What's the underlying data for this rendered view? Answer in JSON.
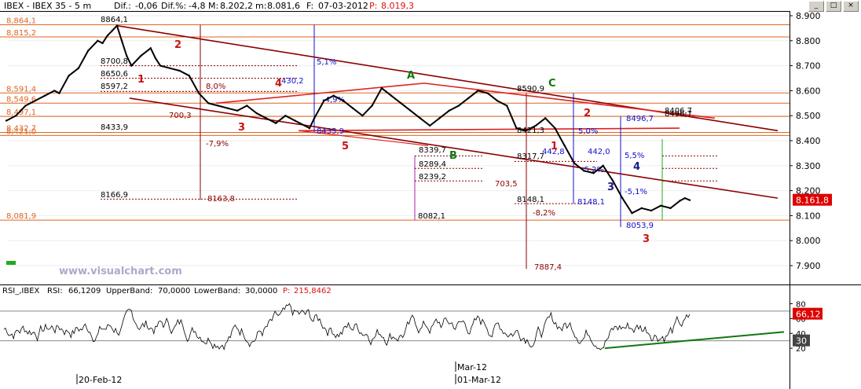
{
  "header": {
    "title": "IBEX - IBEX 35 - 5 m",
    "dif_label": "Dif.:",
    "dif_value": "-0,06",
    "difpct_label": "Dif.%:",
    "difpct_value": "-4,8",
    "m_label": "M:",
    "m_value": "8.202,2",
    "mn_label": "m:",
    "mn_value": "8.081,6",
    "f_label": "F:",
    "f_value": "07-03-2012",
    "p_label": "P:",
    "p_value": "8.019,3"
  },
  "watermark": "www.visualchart.com",
  "rsi_header": {
    "label": "RSI_,IBEX",
    "rsi_label": "RSI:",
    "rsi_value": "66,1209",
    "upper_label": "UpperBand:",
    "upper_value": "70,0000",
    "lower_label": "LowerBand:",
    "lower_value": "30,0000",
    "p_label": "P:",
    "p_value": "215,8462"
  },
  "window_buttons": [
    "_",
    "□",
    "×"
  ],
  "colors": {
    "candles": "#000000",
    "channel": "#8b0000",
    "triangle": "#dd2222",
    "support_lines": "#dd6622",
    "blue_measure": "#1111cc",
    "last_price_bg": "#dd0000",
    "rsi_line": "#000000",
    "rsi_up": "#1133dd",
    "rsi_down": "#dd2222",
    "rsi_trend": "#117711",
    "wave_red": "#cc1111",
    "wave_green": "#117711",
    "wave_blue": "#1a1a88",
    "purple": "#aa22aa",
    "green_box": "#22aa22"
  },
  "chart_data": [
    {
      "type": "line",
      "title": "IBEX - IBEX 35 - 5 m",
      "y_axis_ticks": [
        "8.900",
        "8.800",
        "8.700",
        "8.600",
        "8.500",
        "8.400",
        "8.300",
        "8.200",
        "8.100",
        "8.000",
        "7.900"
      ],
      "ylim": [
        7.87,
        8.92
      ],
      "x_axis_labels": [
        "20-Feb-12",
        "Mar-12",
        "01-Mar-12"
      ],
      "last_price": "8.161,8",
      "series": [
        {
          "points": [
            [
              0,
              8.48
            ],
            [
              2,
              8.5
            ],
            [
              4,
              8.54
            ],
            [
              6,
              8.56
            ],
            [
              8,
              8.58
            ],
            [
              10,
              8.6
            ],
            [
              11,
              8.59
            ],
            [
              13,
              8.66
            ],
            [
              15,
              8.69
            ],
            [
              17,
              8.76
            ],
            [
              19,
              8.8
            ],
            [
              20,
              8.79
            ],
            [
              21,
              8.82
            ],
            [
              22,
              8.84
            ],
            [
              23,
              8.86
            ],
            [
              24,
              8.8
            ],
            [
              25,
              8.74
            ],
            [
              26,
              8.7
            ],
            [
              28,
              8.74
            ],
            [
              30,
              8.77
            ],
            [
              31,
              8.73
            ],
            [
              32,
              8.7
            ],
            [
              34,
              8.69
            ],
            [
              36,
              8.68
            ],
            [
              38,
              8.66
            ],
            [
              40,
              8.59
            ],
            [
              42,
              8.55
            ],
            [
              44,
              8.54
            ],
            [
              46,
              8.53
            ],
            [
              48,
              8.52
            ],
            [
              50,
              8.54
            ],
            [
              52,
              8.51
            ],
            [
              54,
              8.49
            ],
            [
              56,
              8.47
            ],
            [
              58,
              8.5
            ],
            [
              60,
              8.48
            ],
            [
              62,
              8.46
            ],
            [
              63,
              8.45
            ],
            [
              64,
              8.49
            ],
            [
              66,
              8.56
            ],
            [
              68,
              8.58
            ],
            [
              70,
              8.56
            ],
            [
              72,
              8.53
            ],
            [
              74,
              8.5
            ],
            [
              76,
              8.54
            ],
            [
              78,
              8.61
            ],
            [
              80,
              8.58
            ],
            [
              82,
              8.55
            ],
            [
              84,
              8.52
            ],
            [
              86,
              8.49
            ],
            [
              88,
              8.46
            ],
            [
              90,
              8.49
            ],
            [
              92,
              8.52
            ],
            [
              94,
              8.54
            ],
            [
              96,
              8.57
            ],
            [
              98,
              8.6
            ],
            [
              100,
              8.59
            ],
            [
              102,
              8.56
            ],
            [
              104,
              8.54
            ],
            [
              106,
              8.45
            ],
            [
              108,
              8.44
            ],
            [
              110,
              8.46
            ],
            [
              112,
              8.49
            ],
            [
              114,
              8.45
            ],
            [
              116,
              8.38
            ],
            [
              118,
              8.31
            ],
            [
              120,
              8.28
            ],
            [
              122,
              8.27
            ],
            [
              124,
              8.3
            ],
            [
              126,
              8.24
            ],
            [
              128,
              8.17
            ],
            [
              130,
              8.11
            ],
            [
              132,
              8.13
            ],
            [
              134,
              8.12
            ],
            [
              136,
              8.14
            ],
            [
              138,
              8.13
            ],
            [
              140,
              8.16
            ],
            [
              141,
              8.17
            ],
            [
              142,
              8.162
            ]
          ]
        }
      ],
      "price_levels": [
        {
          "label": "8,864,1",
          "value": 8.864
        },
        {
          "label": "8,815,2",
          "value": 8.815
        },
        {
          "label": "8,591,4",
          "value": 8.591
        },
        {
          "label": "8,549,6",
          "value": 8.55
        },
        {
          "label": "8,497,1",
          "value": 8.497
        },
        {
          "label": "8,432,7",
          "value": 8.433
        },
        {
          "label": "8,421,0",
          "value": 8.421
        },
        {
          "label": "8,081,9",
          "value": 8.082
        }
      ],
      "annotations": [
        "8864,1",
        "8700,8",
        "8650,6",
        "8597,2",
        "8433,9",
        "8166,9",
        "8082,1",
        "8339,7",
        "8289,4",
        "8239,2",
        "700,3",
        "703,5",
        "8590,9",
        "8496,7",
        "8421,3",
        "8148,1",
        "8317,7",
        "8053,9",
        "8406,7",
        "442,8",
        "442,0",
        "430,2",
        "7887,4",
        "8163,8",
        "8433,9",
        "8496,7",
        "8148,1",
        "-7,9%",
        "5,1%",
        "-4,9%",
        "8,0%",
        "5,0%",
        "-5,2%",
        "-8,2%",
        "5,5%",
        "-5,1%",
        "1",
        "2",
        "3",
        "4",
        "5",
        "A",
        "B",
        "C"
      ]
    },
    {
      "type": "line",
      "title": "RSI_,IBEX",
      "y_axis_ticks": [
        "80",
        "60",
        "40",
        "20"
      ],
      "ylim": [
        0,
        90
      ],
      "current_rsi": "66,12",
      "upper_band": 70,
      "lower_band": 30,
      "marker_value": "30"
    }
  ]
}
